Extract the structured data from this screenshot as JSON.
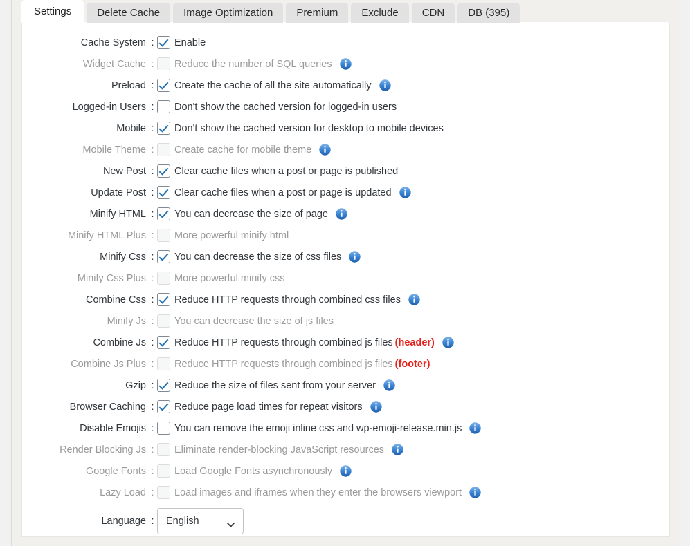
{
  "tabs": [
    {
      "label": "Settings",
      "active": true
    },
    {
      "label": "Delete Cache",
      "active": false
    },
    {
      "label": "Image Optimization",
      "active": false
    },
    {
      "label": "Premium",
      "active": false
    },
    {
      "label": "Exclude",
      "active": false
    },
    {
      "label": "CDN",
      "active": false
    },
    {
      "label": "DB (395)",
      "active": false
    }
  ],
  "colors": {
    "accent": "#2271b1",
    "info_icon": "#3a87d6",
    "tag_red": "#e4211b",
    "disabled_text": "#9a9a9a",
    "text": "#32373c",
    "panel_bg": "#ffffff",
    "tab_bg": "#e2e2e2",
    "page_bg": "#f1f0ec"
  },
  "colon": ":",
  "settings": [
    {
      "label": "Cache System",
      "desc": "Enable",
      "checked": true,
      "disabled": false,
      "info": false,
      "tag": ""
    },
    {
      "label": "Widget Cache",
      "desc": "Reduce the number of SQL queries",
      "checked": false,
      "disabled": true,
      "info": true,
      "tag": ""
    },
    {
      "label": "Preload",
      "desc": "Create the cache of all the site automatically",
      "checked": true,
      "disabled": false,
      "info": true,
      "tag": ""
    },
    {
      "label": "Logged-in Users",
      "desc": "Don't show the cached version for logged-in users",
      "checked": false,
      "disabled": false,
      "info": false,
      "tag": ""
    },
    {
      "label": "Mobile",
      "desc": "Don't show the cached version for desktop to mobile devices",
      "checked": true,
      "disabled": false,
      "info": false,
      "tag": ""
    },
    {
      "label": "Mobile Theme",
      "desc": "Create cache for mobile theme",
      "checked": false,
      "disabled": true,
      "info": true,
      "tag": ""
    },
    {
      "label": "New Post",
      "desc": "Clear cache files when a post or page is published",
      "checked": true,
      "disabled": false,
      "info": false,
      "tag": ""
    },
    {
      "label": "Update Post",
      "desc": "Clear cache files when a post or page is updated",
      "checked": true,
      "disabled": false,
      "info": true,
      "tag": ""
    },
    {
      "label": "Minify HTML",
      "desc": "You can decrease the size of page",
      "checked": true,
      "disabled": false,
      "info": true,
      "tag": ""
    },
    {
      "label": "Minify HTML Plus",
      "desc": "More powerful minify html",
      "checked": false,
      "disabled": true,
      "info": false,
      "tag": ""
    },
    {
      "label": "Minify Css",
      "desc": "You can decrease the size of css files",
      "checked": true,
      "disabled": false,
      "info": true,
      "tag": ""
    },
    {
      "label": "Minify Css Plus",
      "desc": "More powerful minify css",
      "checked": false,
      "disabled": true,
      "info": false,
      "tag": ""
    },
    {
      "label": "Combine Css",
      "desc": "Reduce HTTP requests through combined css files",
      "checked": true,
      "disabled": false,
      "info": true,
      "tag": ""
    },
    {
      "label": "Minify Js",
      "desc": "You can decrease the size of js files",
      "checked": false,
      "disabled": true,
      "info": false,
      "tag": ""
    },
    {
      "label": "Combine Js",
      "desc": "Reduce HTTP requests through combined js files",
      "checked": true,
      "disabled": false,
      "info": true,
      "tag": "(header)"
    },
    {
      "label": "Combine Js Plus",
      "desc": "Reduce HTTP requests through combined js files",
      "checked": false,
      "disabled": true,
      "info": false,
      "tag": "(footer)"
    },
    {
      "label": "Gzip",
      "desc": "Reduce the size of files sent from your server",
      "checked": true,
      "disabled": false,
      "info": true,
      "tag": ""
    },
    {
      "label": "Browser Caching",
      "desc": "Reduce page load times for repeat visitors",
      "checked": true,
      "disabled": false,
      "info": true,
      "tag": ""
    },
    {
      "label": "Disable Emojis",
      "desc": "You can remove the emoji inline css and wp-emoji-release.min.js",
      "checked": false,
      "disabled": false,
      "info": true,
      "tag": ""
    },
    {
      "label": "Render Blocking Js",
      "desc": "Eliminate render-blocking JavaScript resources",
      "checked": false,
      "disabled": true,
      "info": true,
      "tag": ""
    },
    {
      "label": "Google Fonts",
      "desc": "Load Google Fonts asynchronously",
      "checked": false,
      "disabled": true,
      "info": true,
      "tag": ""
    },
    {
      "label": "Lazy Load",
      "desc": "Load images and iframes when they enter the browsers viewport",
      "checked": false,
      "disabled": true,
      "info": true,
      "tag": ""
    }
  ],
  "language": {
    "label": "Language",
    "selected": "English",
    "options": [
      "English"
    ]
  },
  "icons": {
    "info": "info-circle-icon",
    "chevron": "chevron-down-icon",
    "check": "check-icon"
  }
}
